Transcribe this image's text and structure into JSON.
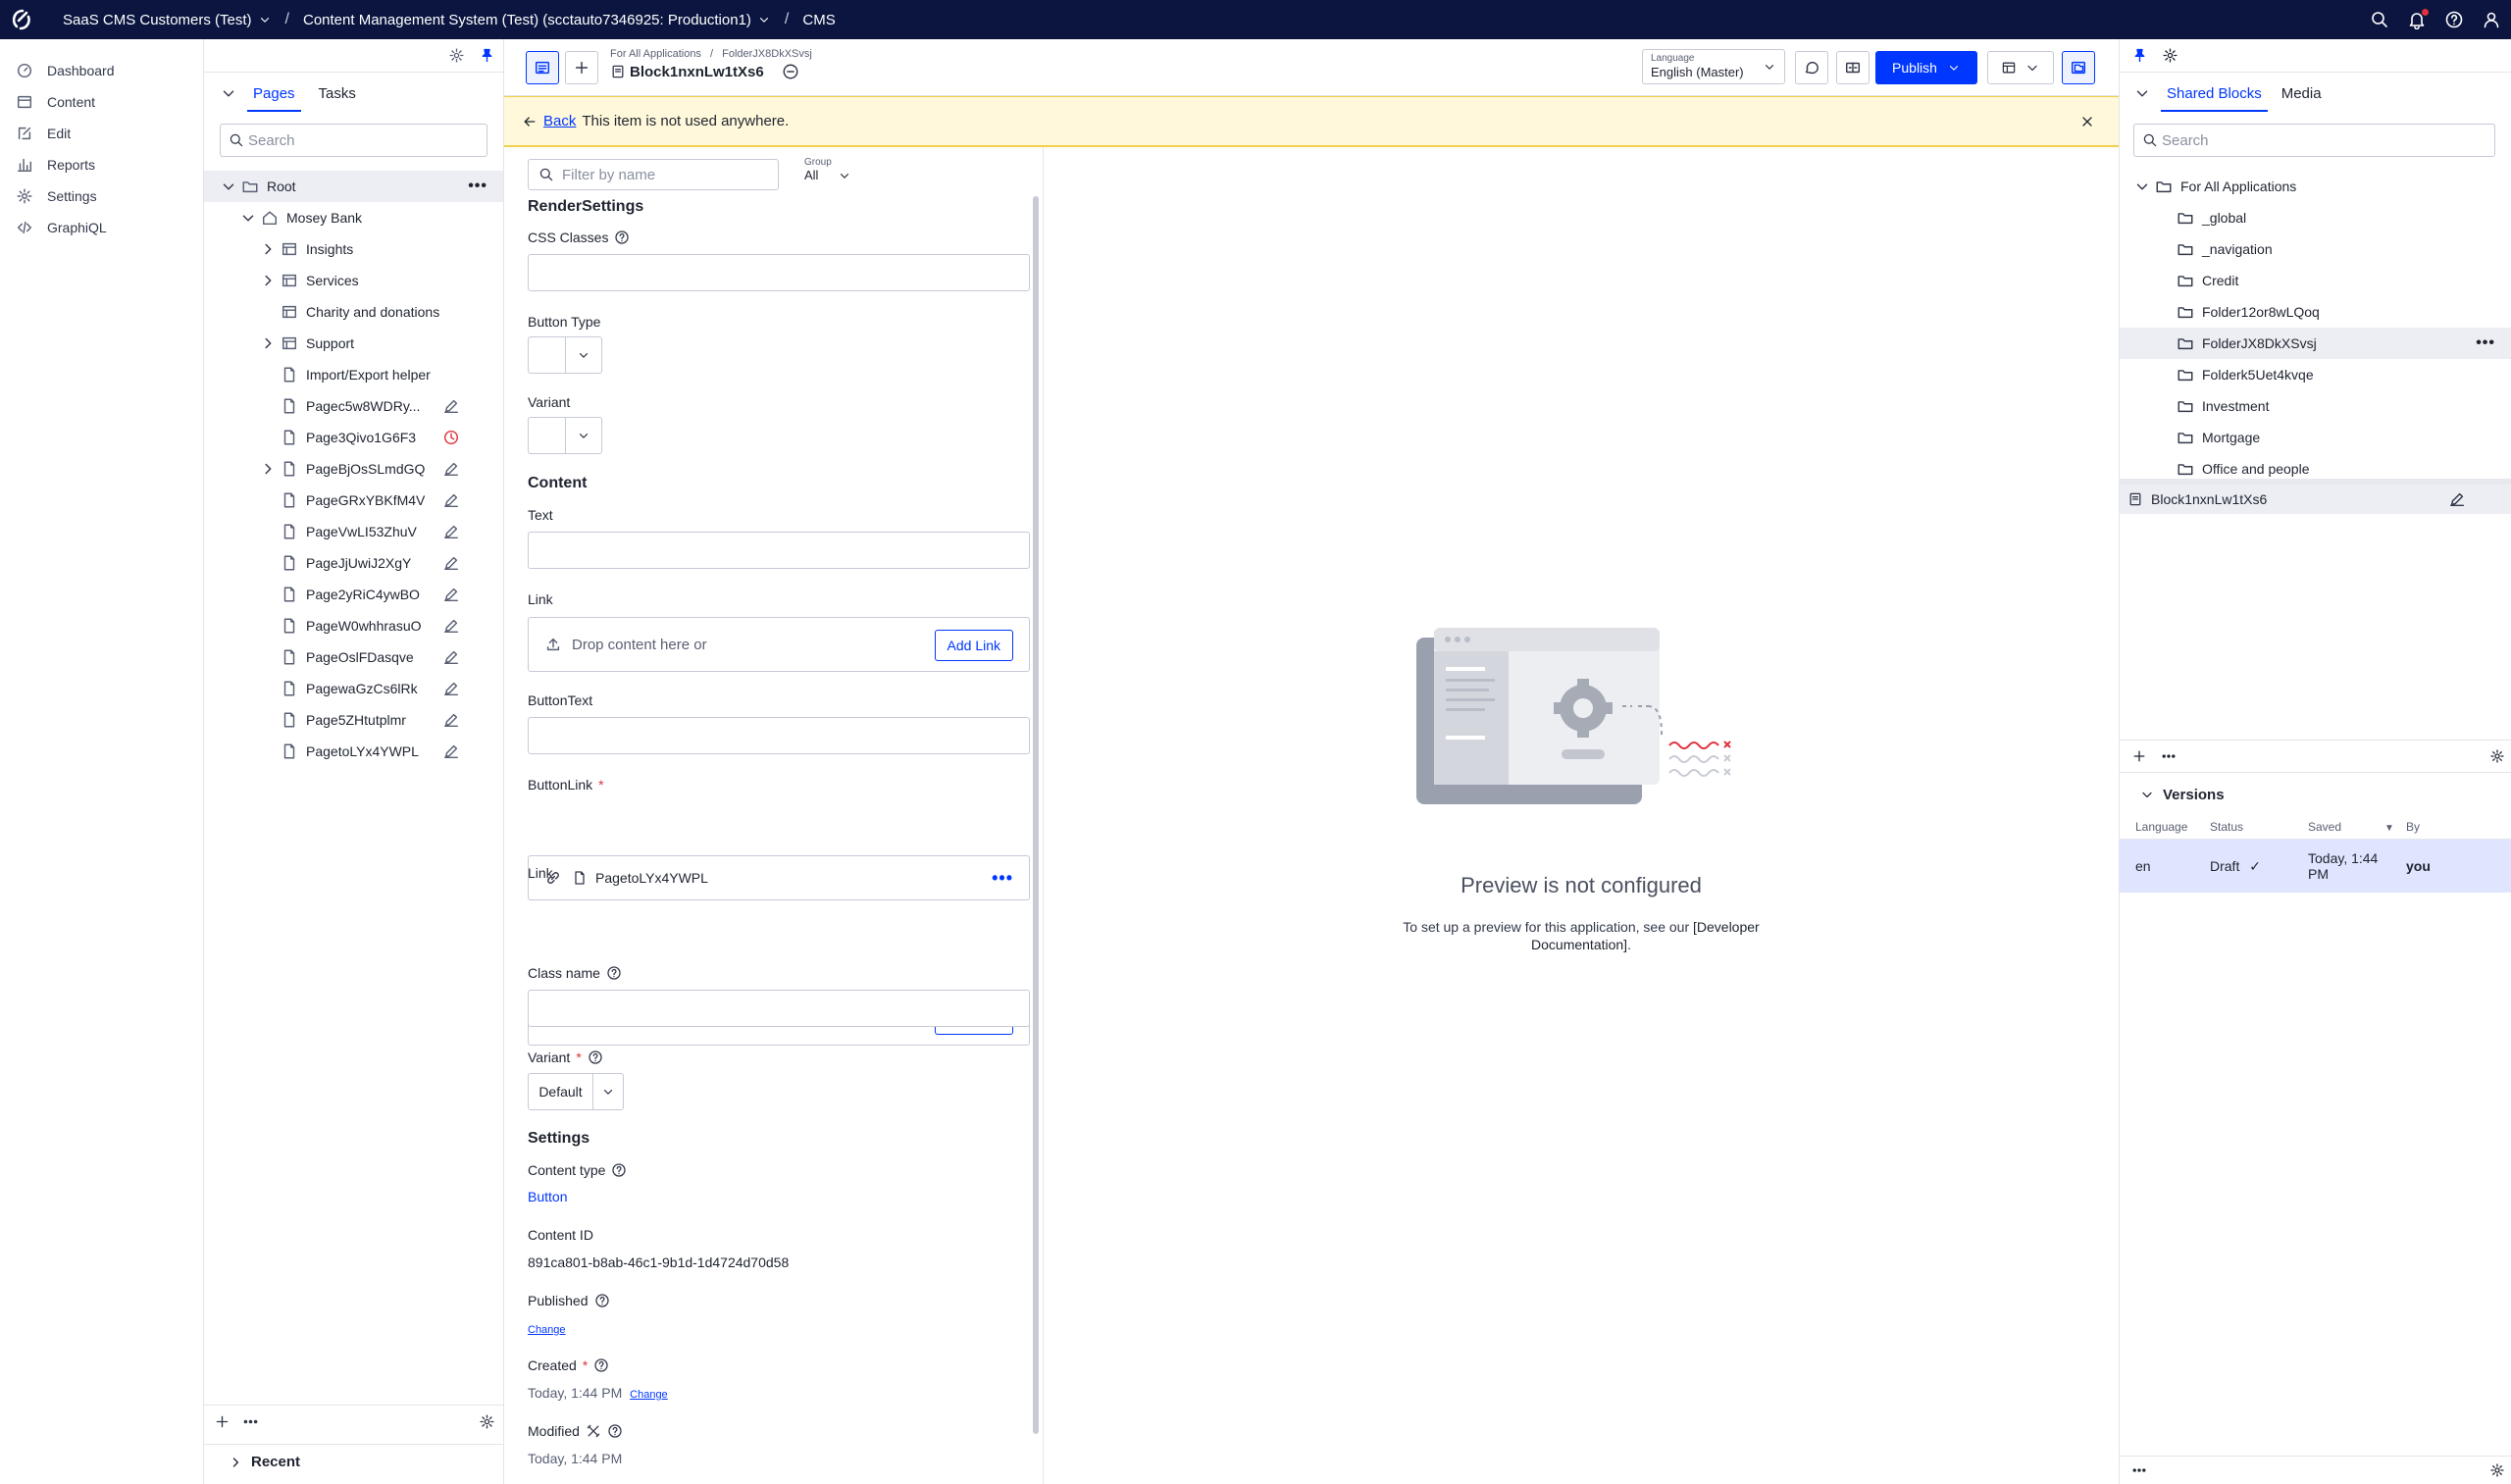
{
  "topbar": {
    "org": "SaaS CMS Customers (Test)",
    "project": "Content Management System (Test) (scctauto7346925: Production1)",
    "app": "CMS"
  },
  "leftnav": {
    "items": [
      {
        "label": "Dashboard",
        "icon": "dashboard-icon"
      },
      {
        "label": "Content",
        "icon": "content-icon"
      },
      {
        "label": "Edit",
        "icon": "edit-icon"
      },
      {
        "label": "Reports",
        "icon": "reports-icon"
      },
      {
        "label": "Settings",
        "icon": "settings-icon"
      },
      {
        "label": "GraphiQL",
        "icon": "code-icon"
      }
    ]
  },
  "pages_panel": {
    "tabs": [
      "Pages",
      "Tasks"
    ],
    "search_placeholder": "Search",
    "tree": [
      {
        "label": "Root",
        "level": 0,
        "icon": "folder",
        "expanded": true
      },
      {
        "label": "Mosey Bank",
        "level": 1,
        "icon": "home",
        "expanded": true
      },
      {
        "label": "Insights",
        "level": 2,
        "icon": "table",
        "collapsed": true
      },
      {
        "label": "Services",
        "level": 2,
        "icon": "table",
        "collapsed": true
      },
      {
        "label": "Charity and donations",
        "level": 2,
        "icon": "table"
      },
      {
        "label": "Support",
        "level": 2,
        "icon": "table",
        "collapsed": true
      },
      {
        "label": "Import/Export helper",
        "level": 2,
        "icon": "page"
      },
      {
        "label": "Pagec5w8WDRy...",
        "level": 2,
        "icon": "page",
        "status": "edit"
      },
      {
        "label": "Page3Qivo1G6F3",
        "level": 2,
        "icon": "page",
        "status": "scheduled"
      },
      {
        "label": "PageBjOsSLmdGQ",
        "level": 2,
        "icon": "page",
        "status": "edit",
        "collapsed": true
      },
      {
        "label": "PageGRxYBKfM4V",
        "level": 2,
        "icon": "page",
        "status": "edit"
      },
      {
        "label": "PageVwLI53ZhuV",
        "level": 2,
        "icon": "page",
        "status": "edit"
      },
      {
        "label": "PageJjUwiJ2XgY",
        "level": 2,
        "icon": "page",
        "status": "edit"
      },
      {
        "label": "Page2yRiC4ywBO",
        "level": 2,
        "icon": "page",
        "status": "edit"
      },
      {
        "label": "PageW0whhrasuO",
        "level": 2,
        "icon": "page",
        "status": "edit"
      },
      {
        "label": "PageOslFDasqve",
        "level": 2,
        "icon": "page",
        "status": "edit"
      },
      {
        "label": "PagewaGzCs6lRk",
        "level": 2,
        "icon": "page",
        "status": "edit"
      },
      {
        "label": "Page5ZHtutplmr",
        "level": 2,
        "icon": "page",
        "status": "edit"
      },
      {
        "label": "PagetoLYx4YWPL",
        "level": 2,
        "icon": "page",
        "status": "edit"
      }
    ],
    "recent_label": "Recent"
  },
  "editor": {
    "path": [
      "For All Applications",
      "FolderJX8DkXSvsj"
    ],
    "title": "Block1nxnLw1tXs6",
    "language_label": "Language",
    "language_value": "English (Master)",
    "publish_label": "Publish"
  },
  "notice": {
    "back_label": "Back",
    "text": "This item is not used anywhere."
  },
  "form": {
    "filter_placeholder": "Filter by name",
    "group_label": "Group",
    "group_value": "All",
    "render_settings_title": "RenderSettings",
    "css_classes_label": "CSS Classes",
    "button_type_label": "Button Type",
    "variant_label": "Variant",
    "content_title": "Content",
    "text_label": "Text",
    "link_label": "Link",
    "drop_text": "Drop content here or",
    "add_link_label": "Add Link",
    "button_text_label": "ButtonText",
    "button_link_label": "ButtonLink",
    "button_link_value": "PagetoLYx4YWPL",
    "link2_label": "Link",
    "class_name_label": "Class name",
    "variant2_label": "Variant",
    "variant2_value": "Default",
    "settings_title": "Settings",
    "content_type_label": "Content type",
    "content_type_value": "Button",
    "content_id_label": "Content ID",
    "content_id_value": "891ca801-b8ab-46c1-9b1d-1d4724d70d58",
    "published_label": "Published",
    "change_label": "Change",
    "created_label": "Created",
    "created_value": "Today, 1:44 PM",
    "modified_label": "Modified",
    "modified_value": "Today, 1:44 PM"
  },
  "preview": {
    "title": "Preview is not configured",
    "desc_prefix": "To set up a preview for this application, see our ",
    "desc_link": "[Developer Documentation]",
    "desc_suffix": "."
  },
  "right_panel": {
    "tabs": [
      "Shared Blocks",
      "Media"
    ],
    "search_placeholder": "Search",
    "tree": [
      {
        "label": "For All Applications",
        "level": 0,
        "expanded": true
      },
      {
        "label": "_global",
        "level": 1
      },
      {
        "label": "_navigation",
        "level": 1
      },
      {
        "label": "Credit",
        "level": 1
      },
      {
        "label": "Folder12or8wLQoq",
        "level": 1
      },
      {
        "label": "FolderJX8DkXSvsj",
        "level": 1,
        "selected": true
      },
      {
        "label": "Folderk5Uet4kvqe",
        "level": 1
      },
      {
        "label": "Investment",
        "level": 1
      },
      {
        "label": "Mortgage",
        "level": 1
      },
      {
        "label": "Office and people",
        "level": 1
      }
    ],
    "block_item": "Block1nxnLw1tXs6",
    "versions": {
      "title": "Versions",
      "columns": [
        "Language",
        "Status",
        "Saved",
        "By"
      ],
      "rows": [
        {
          "language": "en",
          "status": "Draft",
          "saved": "Today, 1:44 PM",
          "by": "you"
        }
      ]
    }
  },
  "colors": {
    "topbar": "#0b1540",
    "accent": "#0037ff",
    "notice_bg": "#fff8da",
    "danger": "#e0323c"
  }
}
